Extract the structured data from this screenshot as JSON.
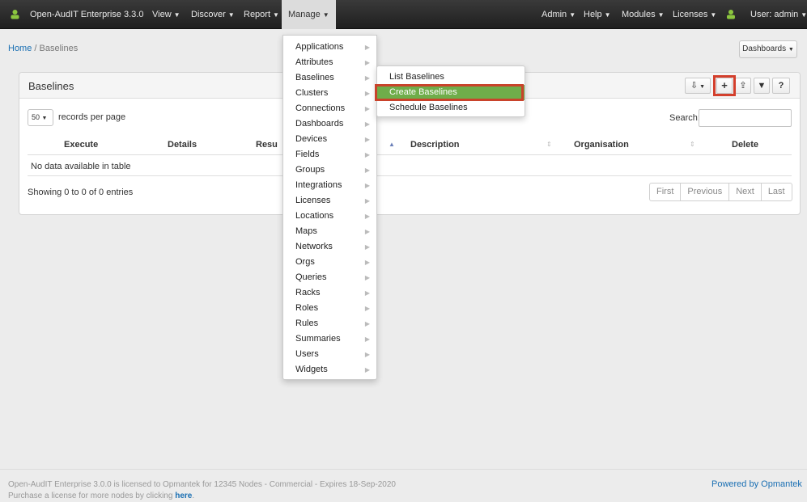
{
  "navbar": {
    "brand": "Open-AudIT Enterprise 3.3.0",
    "left_menus": [
      "View",
      "Discover",
      "Report",
      "Manage"
    ],
    "right_menus": [
      "Admin",
      "Help",
      "Modules",
      "Licenses"
    ],
    "user": "User: admin"
  },
  "breadcrumb": {
    "home": "Home",
    "separator": "/",
    "current": "Baselines"
  },
  "dashboards_button": "Dashboards",
  "panel": {
    "title": "Baselines",
    "toolbar": {
      "add": "+",
      "help": "?"
    },
    "records_per_page_value": "50",
    "records_per_page_label": "records per page",
    "search_label": "Search:",
    "columns": [
      "Execute",
      "Details",
      "Resu",
      "Description",
      "Organisation",
      "Delete"
    ],
    "empty_message": "No data available in table",
    "showing": "Showing 0 to 0 of 0 entries",
    "pager": [
      "First",
      "Previous",
      "Next",
      "Last"
    ]
  },
  "manage_menu": [
    "Applications",
    "Attributes",
    "Baselines",
    "Clusters",
    "Connections",
    "Dashboards",
    "Devices",
    "Fields",
    "Groups",
    "Integrations",
    "Licenses",
    "Locations",
    "Maps",
    "Networks",
    "Orgs",
    "Queries",
    "Racks",
    "Roles",
    "Rules",
    "Summaries",
    "Users",
    "Widgets"
  ],
  "baselines_submenu": [
    "List Baselines",
    "Create Baselines",
    "Schedule Baselines"
  ],
  "footer": {
    "license_text": "Open-AudIT Enterprise 3.0.0 is licensed to Opmantek for 12345 Nodes - Commercial - Expires 18-Sep-2020",
    "purchase_text": "Purchase a license for more nodes by clicking",
    "purchase_link": "here",
    "purchase_end": ".",
    "powered_by": "Powered by Opmantek"
  },
  "colors": {
    "navbar": "#2a2a2a",
    "active_item": "#6fad4a",
    "highlight": "#d33f2c",
    "link": "#1a6fb3"
  }
}
